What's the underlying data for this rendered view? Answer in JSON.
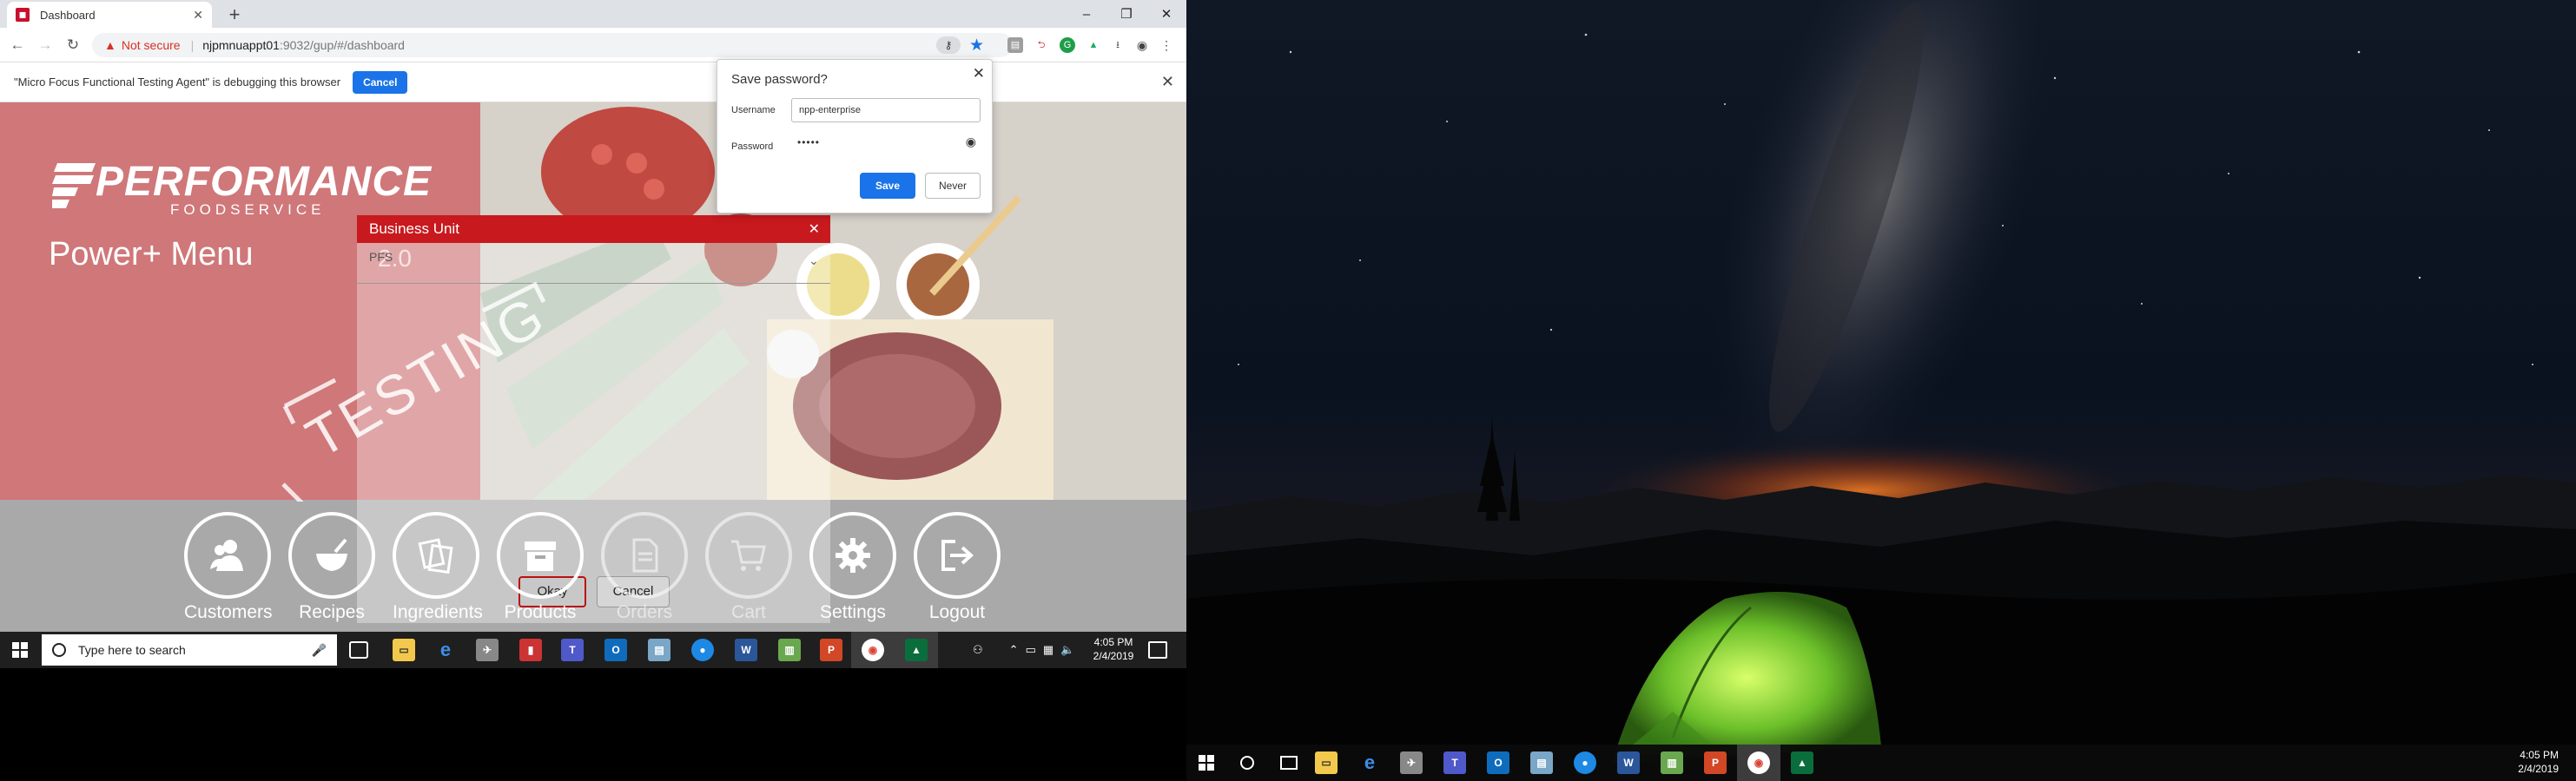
{
  "browser": {
    "tab_title": "Dashboard",
    "url_warning": "Not secure",
    "url_host": "njpmnuappt01",
    "url_path": ":9032/gup/#/dashboard",
    "new_tab": "+"
  },
  "infobar": {
    "message": "\"Micro Focus Functional Testing Agent\" is debugging this browser",
    "cancel_label": "Cancel"
  },
  "save_password": {
    "title": "Save password?",
    "username_label": "Username",
    "username_value": "npp-enterprise",
    "password_label": "Password",
    "password_value": "•••••",
    "save_label": "Save",
    "never_label": "Never"
  },
  "app": {
    "brand": "PERFORMANCE",
    "brand_sub": "FOODSERVICE",
    "title": "Power+ Menu",
    "watermark": "TESTING",
    "brand_color": "#c8191e"
  },
  "business_unit": {
    "title": "Business Unit",
    "selected": "PFS",
    "version": "2.0",
    "okay_label": "Okay",
    "cancel_label": "Cancel"
  },
  "nav": [
    {
      "label": "Customers",
      "icon": "customers-icon",
      "enabled": true
    },
    {
      "label": "Recipes",
      "icon": "recipes-icon",
      "enabled": true
    },
    {
      "label": "Ingredients",
      "icon": "ingredients-icon",
      "enabled": true
    },
    {
      "label": "Products",
      "icon": "products-icon",
      "enabled": true
    },
    {
      "label": "Orders",
      "icon": "orders-icon",
      "enabled": false
    },
    {
      "label": "Cart",
      "icon": "cart-icon",
      "enabled": false
    },
    {
      "label": "Settings",
      "icon": "settings-icon",
      "enabled": true
    },
    {
      "label": "Logout",
      "icon": "logout-icon",
      "enabled": true
    }
  ],
  "taskbar_left": {
    "search_placeholder": "Type here to search",
    "time": "4:05 PM",
    "date": "2/4/2019"
  },
  "taskbar_right": {
    "time": "4:05 PM",
    "date": "2/4/2019"
  }
}
